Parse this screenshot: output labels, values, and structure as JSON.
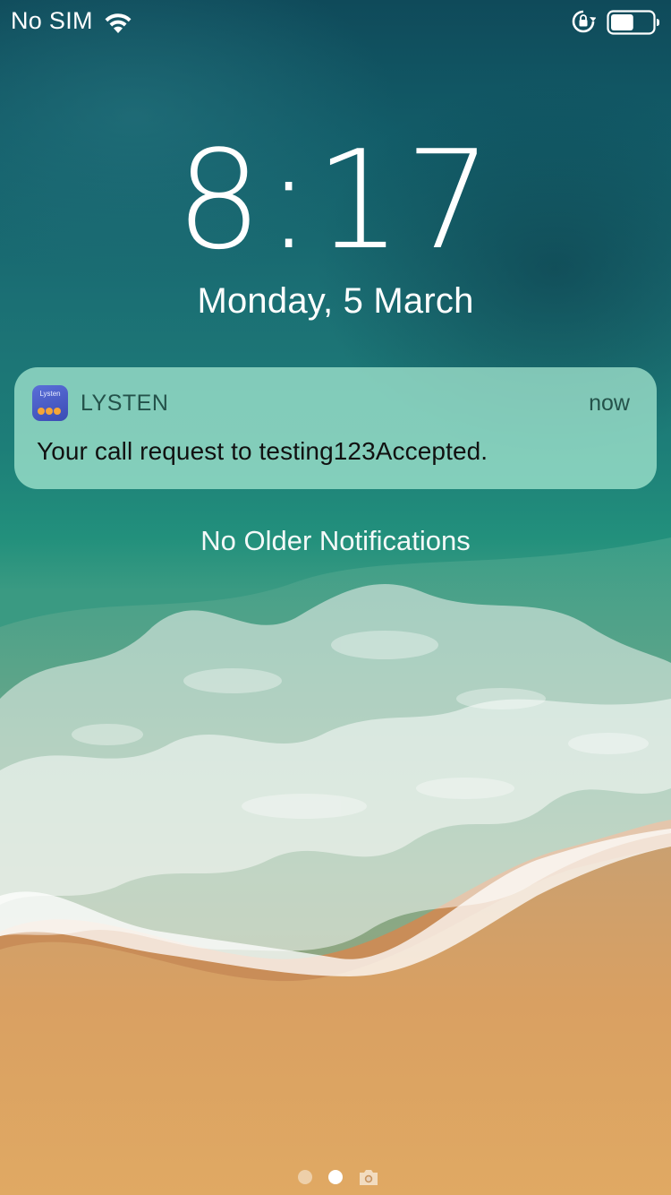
{
  "status_bar": {
    "carrier": "No SIM",
    "wifi_icon": "wifi-icon",
    "orientation_lock_icon": "orientation-lock-icon",
    "battery_icon": "battery-icon",
    "battery_level_fraction": 0.55
  },
  "lock_screen": {
    "time": "8:17",
    "date": "Monday, 5 March"
  },
  "notification": {
    "app_name": "LYSTEN",
    "app_icon_text": "Lysten",
    "time": "now",
    "message": "Your call request to testing123Accepted."
  },
  "no_older_notifications": "No Older Notifications",
  "page_indicator": {
    "pages": 2,
    "current_page": 2,
    "camera_icon": "camera-icon"
  },
  "colors": {
    "sea_dark": "#0f4a5a",
    "sea_mid": "#1d7e78",
    "sand": "#d9a062",
    "notification_bg": "#aaebd4",
    "app_icon": "#4b5fcc",
    "app_icon_dots": "#f6a637"
  }
}
